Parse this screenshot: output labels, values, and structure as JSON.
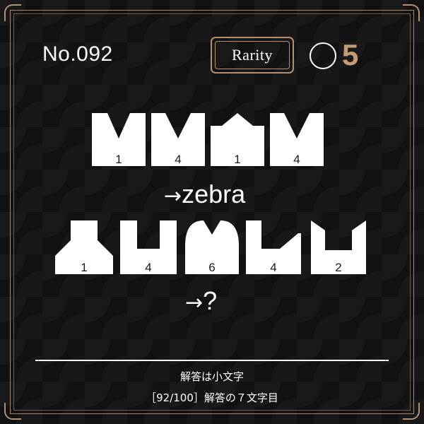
{
  "puzzle": {
    "number": "No.092",
    "rarity_label": "Rarity",
    "rarity_value": "5"
  },
  "row1": {
    "tile_numbers": [
      "1",
      "4",
      "1",
      "4"
    ],
    "answer_prefix": "→",
    "answer": "zebra"
  },
  "row2": {
    "tile_numbers": [
      "1",
      "4",
      "6",
      "4",
      "2"
    ],
    "answer_prefix": "→",
    "answer": "?"
  },
  "footer": {
    "hint": "解答は小文字",
    "progress": "［92/100］解答の７文字目"
  },
  "colors": {
    "background": "#111111",
    "gold": "#b6906e",
    "accent_number": "#c69c74",
    "tile": "#ffffff"
  }
}
